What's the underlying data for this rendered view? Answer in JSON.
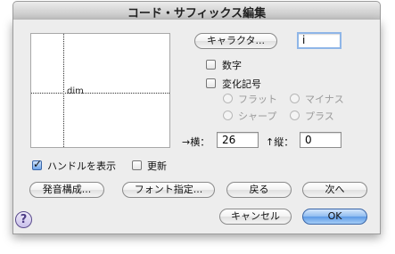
{
  "window": {
    "title": "コード・サフィックス編集"
  },
  "preview": {
    "label": "dim"
  },
  "character_button": {
    "label": "キャラクタ..."
  },
  "character_field": {
    "value": "i"
  },
  "checkboxes": {
    "number": {
      "label": "数字",
      "checked": false
    },
    "accidental": {
      "label": "変化記号",
      "checked": false
    },
    "show_handles": {
      "label": "ハンドルを表示",
      "checked": true
    },
    "update": {
      "label": "更新",
      "checked": false
    }
  },
  "radios": {
    "flat": {
      "label": "フラット"
    },
    "minus": {
      "label": "マイナス"
    },
    "sharp": {
      "label": "シャープ"
    },
    "plus": {
      "label": "プラス"
    }
  },
  "offset": {
    "h_label": "→横：",
    "h_value": "26",
    "v_label": "↑縦：",
    "v_value": "0"
  },
  "buttons": {
    "playback": "発音構成...",
    "font": "フォント指定...",
    "back": "戻る",
    "next": "次へ",
    "cancel": "キャンセル",
    "ok": "OK"
  },
  "help": {
    "glyph": "?"
  }
}
